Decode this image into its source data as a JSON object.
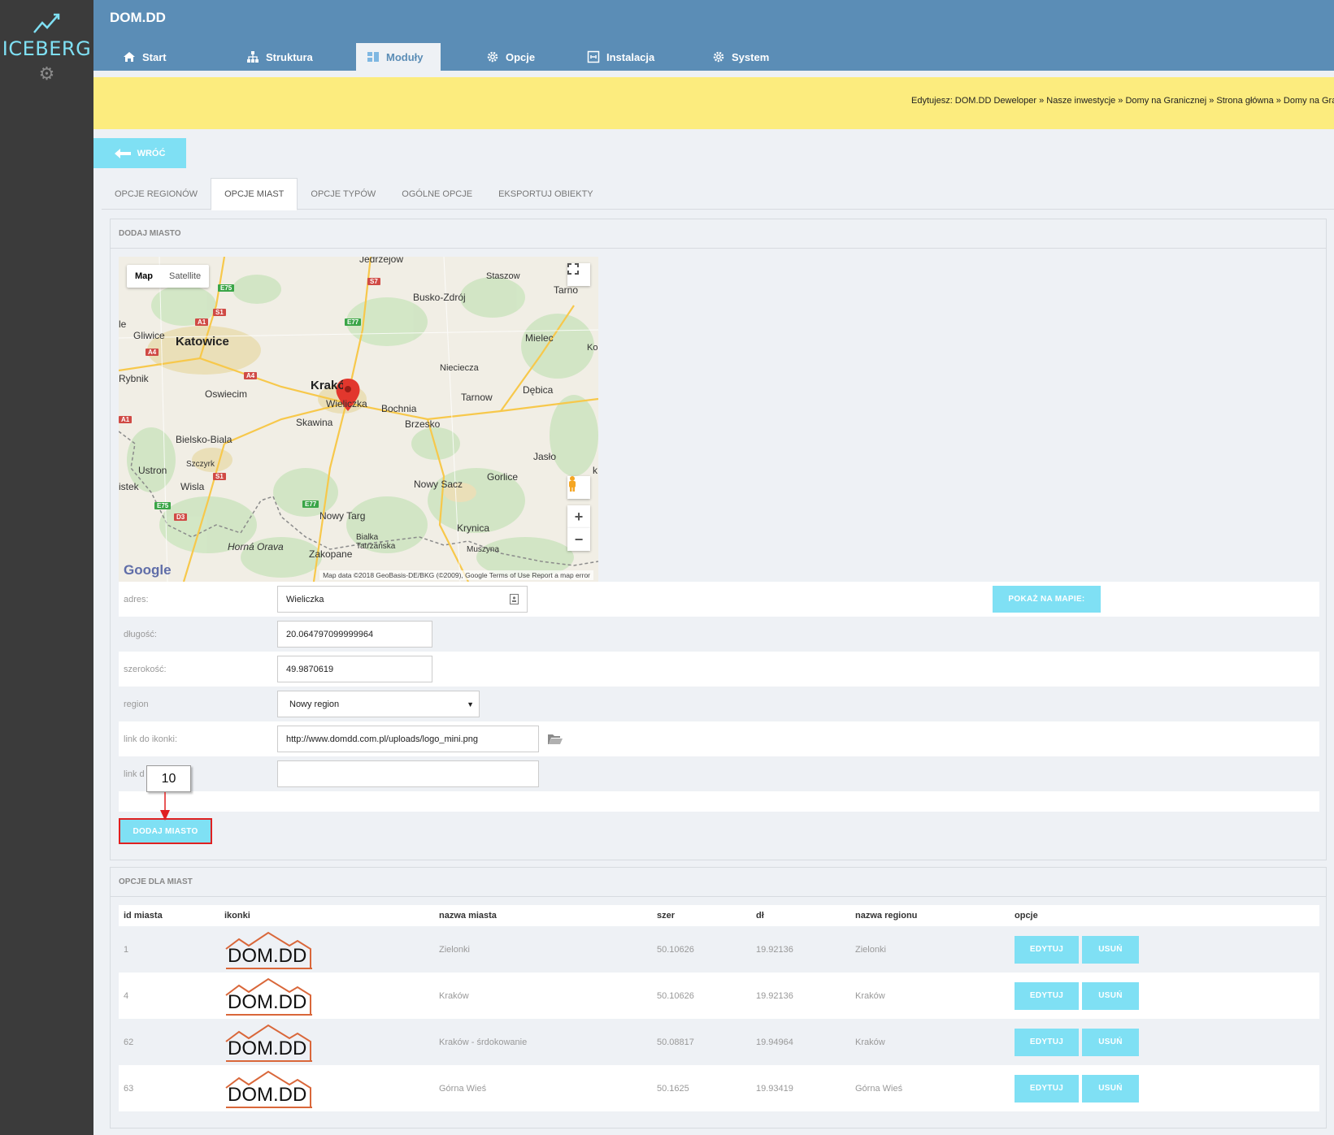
{
  "sidebar": {
    "brand": "ICEBERG"
  },
  "header": {
    "title": "DOM.DD",
    "nav": [
      {
        "label": "Start",
        "icon": "home-icon"
      },
      {
        "label": "Struktura",
        "icon": "sitemap-icon"
      },
      {
        "label": "Moduły",
        "icon": "modules-icon"
      },
      {
        "label": "Opcje",
        "icon": "gear-icon"
      },
      {
        "label": "Instalacja",
        "icon": "install-icon"
      },
      {
        "label": "System",
        "icon": "gear-icon"
      }
    ]
  },
  "breadcrumb": "Edytujesz: DOM.DD Deweloper » Nasze inwestycje » Domy na Granicznej » Strona główna » Domy na Granicznej",
  "back_label": "WRÓĆ",
  "tabs": [
    "OPCJE REGIONÓW",
    "OPCJE MIAST",
    "OPCJE TYPÓW",
    "OGÓLNE OPCJE",
    "EKSPORTUJ OBIEKTY"
  ],
  "add_panel": {
    "title": "DODAJ MIASTO",
    "map": {
      "type_map": "Map",
      "type_satellite": "Satellite",
      "logo": "Google",
      "attribution": "Map data ©2018 GeoBasis-DE/BKG (©2009), Google    Terms of Use    Report a map error",
      "cities": [
        "Jedrzejow",
        "Staszow",
        "Tarno",
        "Busko-Zdrój",
        "Gliwice",
        "Katowice",
        "Mielec",
        "Kol",
        "Niecieczа",
        "Rybnik",
        "Oswiecim",
        "Kraków",
        "Dębica",
        "Tarnow",
        "Wieliczka",
        "Bochnia",
        "Skawina",
        "Brzesko",
        "Bielsko-Biala",
        "Jasło",
        "Szczyrk",
        "Ustron",
        "Gorlice",
        "Nowy Sacz",
        "Wisla",
        "istek",
        "Nowy Targ",
        "Krynica",
        "Bialka Tatrzańska",
        "Horná Orava",
        "Zakopane",
        "Muszyna",
        "le",
        "k"
      ],
      "roads": [
        "E75",
        "S7",
        "S1",
        "A1",
        "E77",
        "A4",
        "A4",
        "A1",
        "S1",
        "E75",
        "D3",
        "E77"
      ]
    },
    "fields": {
      "address_label": "adres:",
      "address_value": "Wieliczka",
      "show_on_map": "POKAŻ NA MAPIE:",
      "lon_label": "długość:",
      "lon_value": "20.064797099999964",
      "lat_label": "szerokość:",
      "lat_value": "49.9870619",
      "region_label": "region",
      "region_value": "Nowy region",
      "icon_link_label": "link do ikonki:",
      "icon_link_value": "http://www.domdd.com.pl/uploads/logo_mini.png",
      "link2_label": "link d",
      "link2_value": ""
    },
    "add_button": "DODAJ MIASTO",
    "annotation": "10"
  },
  "list_panel": {
    "title": "OPCJE DLA MIAST",
    "columns": [
      "id miasta",
      "ikonki",
      "nazwa miasta",
      "szer",
      "dł",
      "nazwa regionu",
      "opcje"
    ],
    "rows": [
      {
        "id": "1",
        "logo": "DOM.DD",
        "name": "Zielonki",
        "szer": "50.10626",
        "dl": "19.92136",
        "region": "Zielonki"
      },
      {
        "id": "4",
        "logo": "DOM.DD",
        "name": "Kraków",
        "szer": "50.10626",
        "dl": "19.92136",
        "region": "Kraków"
      },
      {
        "id": "62",
        "logo": "DOM.DD",
        "name": "Kraków - śrdokowanie",
        "szer": "50.08817",
        "dl": "19.94964",
        "region": "Kraków"
      },
      {
        "id": "63",
        "logo": "DOM.DD",
        "name": "Górna Wieś",
        "szer": "50.1625",
        "dl": "19.93419",
        "region": "Górna Wieś"
      }
    ],
    "edit_label": "EDYTUJ",
    "delete_label": "USUŃ"
  },
  "colors": {
    "topbar": "#5b8db6",
    "sidebar": "#3b3b3b",
    "accent": "#7fe0f4",
    "breadcrumb_bg": "#fcec7e",
    "annotation": "#e02020"
  }
}
